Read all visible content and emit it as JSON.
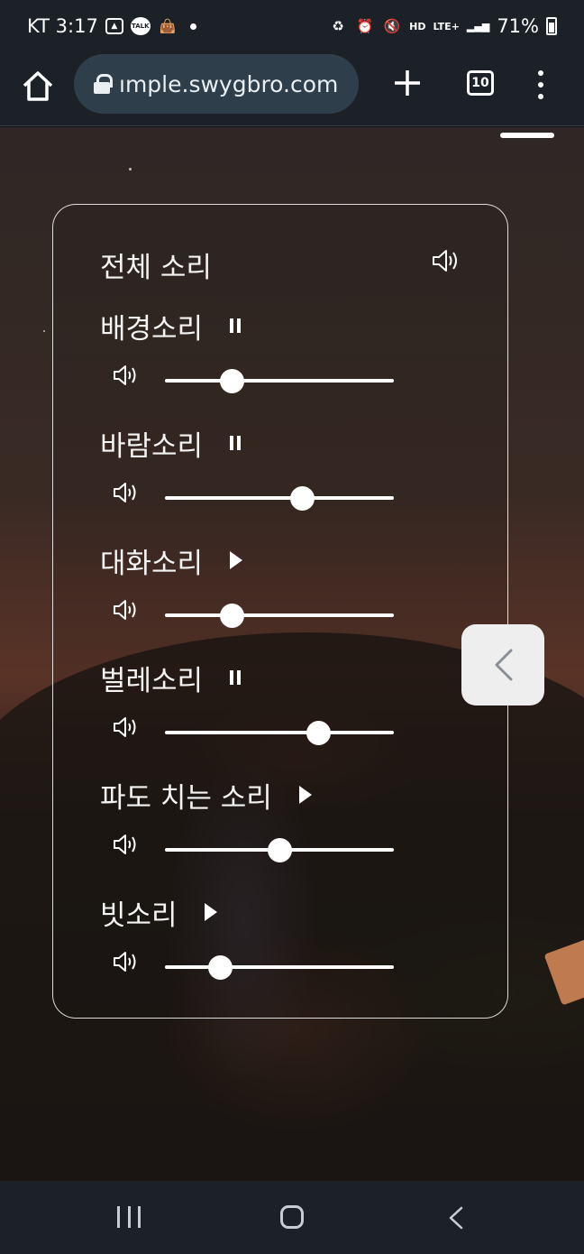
{
  "status_bar": {
    "time": "KT 3:17",
    "talk_badge": "TALK",
    "hd_badge": "HD",
    "network": "LTE+",
    "battery": "71%"
  },
  "browser": {
    "url": "ımple.swygbro.com",
    "tab_count": "10"
  },
  "panel": {
    "master_title": "전체 소리",
    "tracks": [
      {
        "name": "배경소리",
        "state": "playing",
        "control_icon": "pause-icon",
        "volume": 0.29
      },
      {
        "name": "바람소리",
        "state": "playing",
        "control_icon": "pause-icon",
        "volume": 0.6
      },
      {
        "name": "대화소리",
        "state": "stopped",
        "control_icon": "play-icon",
        "volume": 0.29
      },
      {
        "name": "벌레소리",
        "state": "playing",
        "control_icon": "pause-icon",
        "volume": 0.67
      },
      {
        "name": "파도 치는 소리",
        "state": "stopped",
        "control_icon": "play-icon",
        "volume": 0.5
      },
      {
        "name": "빗소리",
        "state": "stopped",
        "control_icon": "play-icon",
        "volume": 0.24
      }
    ]
  },
  "colors": {
    "bar_bg": "#1c2127",
    "url_pill": "#2e3e4b",
    "panel_border": "#ffffff",
    "toggle_bg": "#eeeeee"
  }
}
